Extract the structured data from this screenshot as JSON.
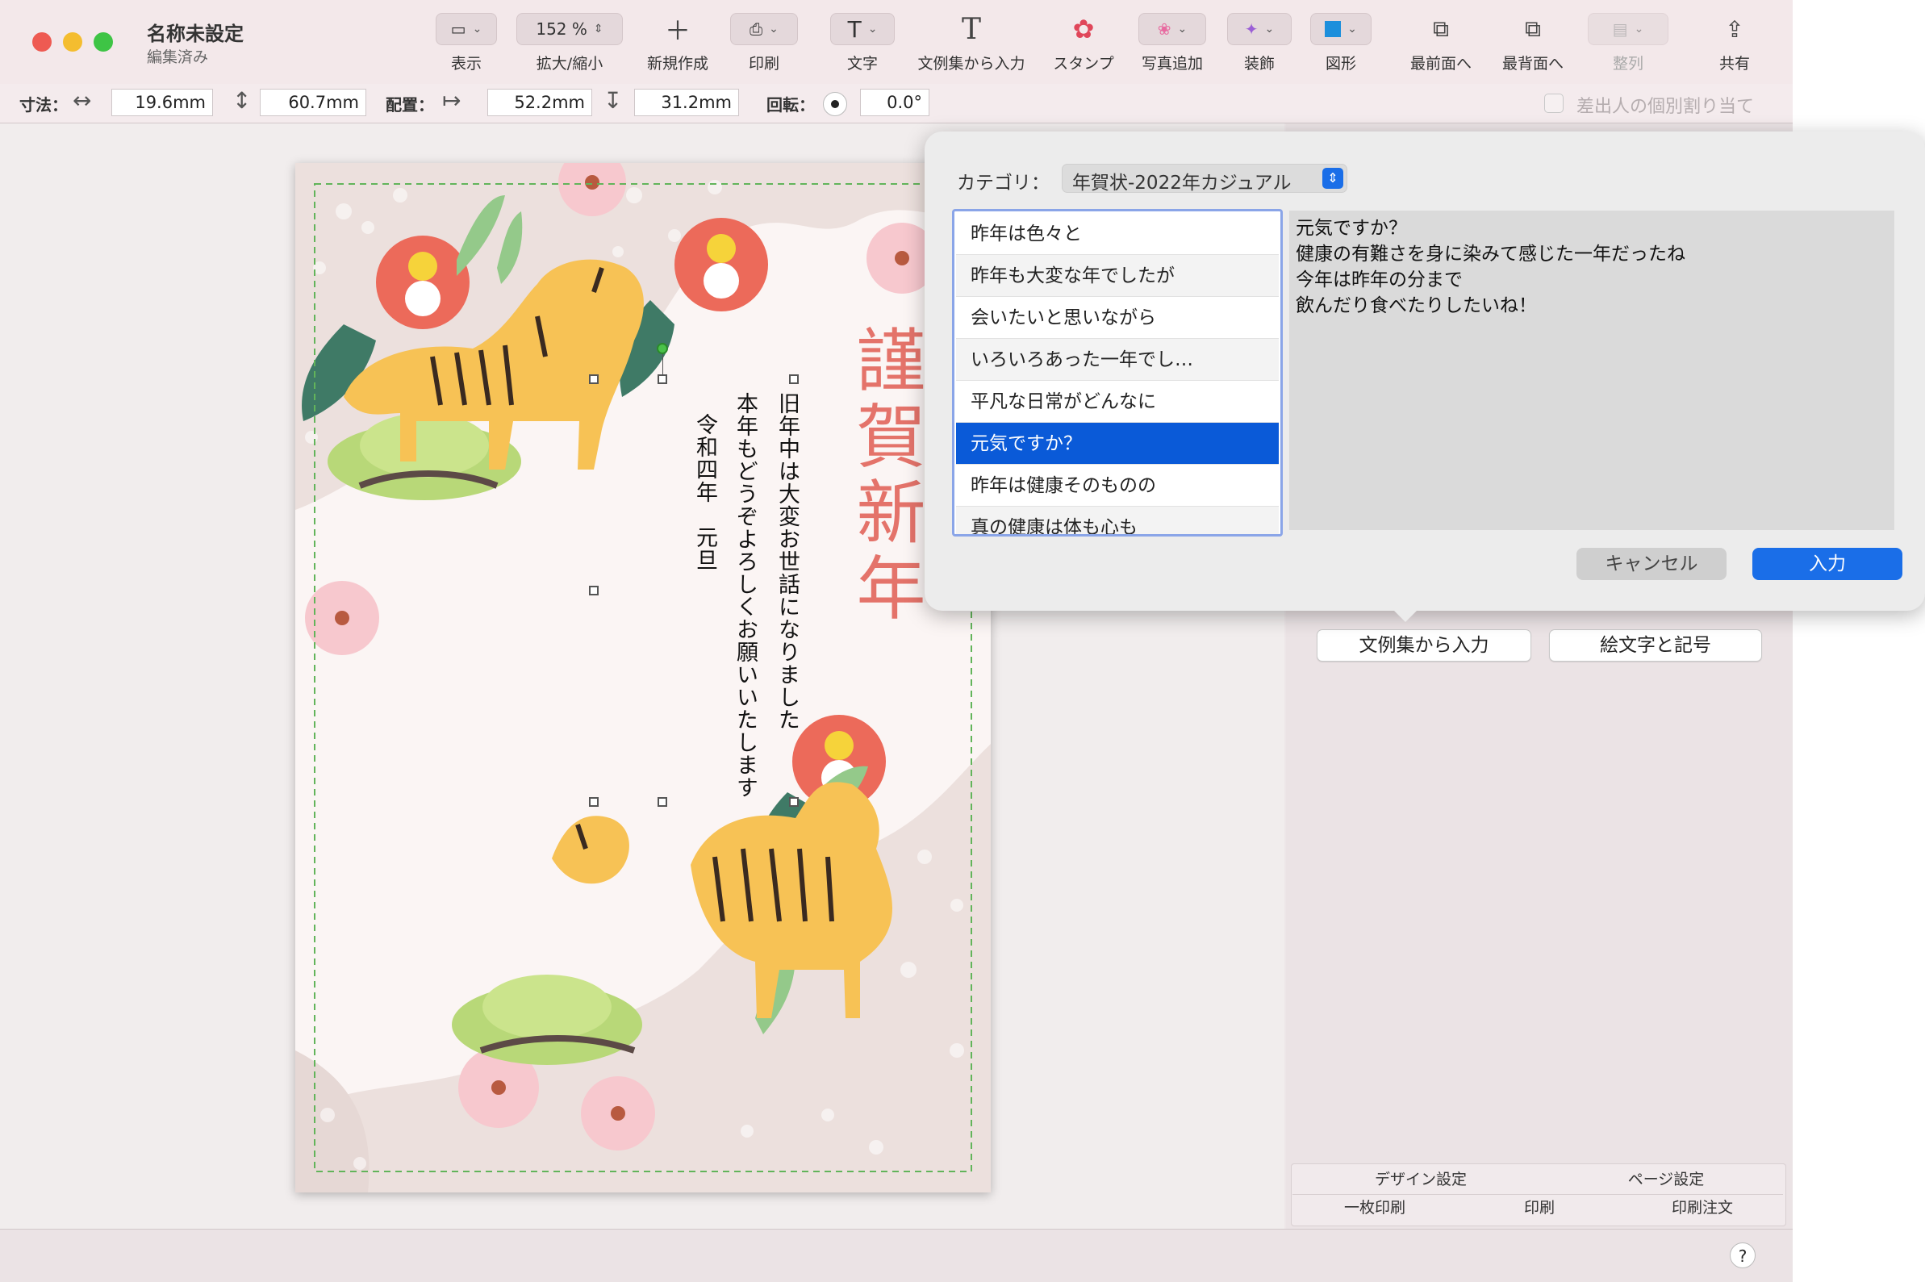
{
  "window": {
    "title": "名称未設定",
    "subtitle": "編集済み"
  },
  "toolbar": {
    "view": "表示",
    "zoom_value": "152 %",
    "zoom": "拡大/縮小",
    "new": "新規作成",
    "print": "印刷",
    "text": "文字",
    "phrase_insert": "文例集から入力",
    "stamp": "スタンプ",
    "photo": "写真追加",
    "decor": "装飾",
    "shape": "図形",
    "front": "最前面へ",
    "back": "最背面へ",
    "align": "整列",
    "share": "共有"
  },
  "dimensions": {
    "size_label": "寸法：",
    "width": "19.6mm",
    "height": "60.7mm",
    "position_label": "配置：",
    "x": "52.2mm",
    "y": "31.2mm",
    "rotation_label": "回転：",
    "rotation": "0.0°",
    "recipient_label": "差出人の個別割り当て"
  },
  "card": {
    "greeting": "謹賀新年",
    "line1": "旧年中は大変お世話になりました",
    "line2": "本年もどうぞよろしくお願いいたします",
    "date": "令和四年　元旦"
  },
  "popover": {
    "category_label": "カテゴリ：",
    "category_value": "年賀状-2022年カジュアル",
    "phrases": [
      "昨年は色々と",
      "昨年も大変な年でしたが",
      "会いたいと思いながら",
      "いろいろあった一年でし…",
      "平凡な日常がどんなに",
      "元気ですか？",
      "昨年は健康そのものの",
      "真の健康は体も心も"
    ],
    "selected_index": 5,
    "preview_lines": [
      "元気ですか？",
      "健康の有難さを身に染みて感じた一年だったね",
      "今年は昨年の分まで",
      "飲んだり食べたりしたいね！"
    ],
    "cancel": "キャンセル",
    "ok": "入力"
  },
  "side": {
    "phrase_button": "文例集から入力",
    "emoji_button": "絵文字と記号"
  },
  "tabs": {
    "design": "デザイン設定",
    "page": "ページ設定",
    "single_print": "一枚印刷",
    "print": "印刷",
    "order": "印刷注文"
  },
  "help": "?",
  "colors": {
    "accent": "#1a6ee8",
    "selection": "#0a5ad8",
    "greeting": "#e4736a"
  }
}
